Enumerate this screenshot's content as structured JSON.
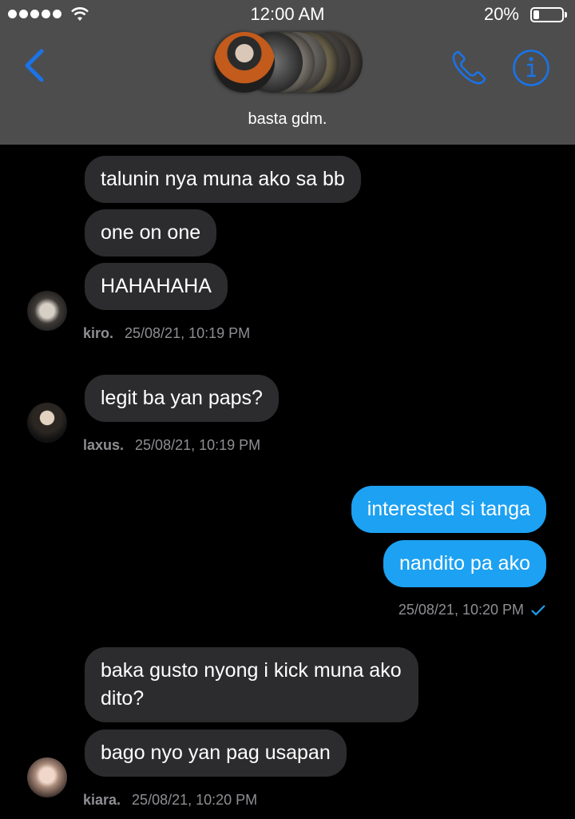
{
  "status_bar": {
    "time": "12:00 AM",
    "battery_percent": "20%",
    "battery_level": 0.2,
    "signal_icon": "signal-dots-icon",
    "wifi_icon": "wifi-icon"
  },
  "header": {
    "group_name": "basta gdm.",
    "back_icon": "chevron-left-icon",
    "call_icon": "phone-icon",
    "info_icon": "info-icon",
    "accent_color": "#1a73e8"
  },
  "messages": [
    {
      "from": "kiro.",
      "text": "talunin nya muna ako sa bb"
    },
    {
      "from": "kiro.",
      "text": "one on one"
    },
    {
      "from": "kiro.",
      "text": "HAHAHAHA"
    },
    {
      "from": "laxus.",
      "text": "legit ba yan paps?"
    },
    {
      "from": "me",
      "text": "interested si tanga"
    },
    {
      "from": "me",
      "text": "nandito pa ako"
    },
    {
      "from": "kiara.",
      "text": "baka gusto nyong i kick muna ako dito?"
    },
    {
      "from": "kiara.",
      "text": "bago nyo yan pag usapan"
    }
  ],
  "meta": {
    "kiro": {
      "name": "kiro.",
      "timestamp": "25/08/21, 10:19 PM"
    },
    "laxus": {
      "name": "laxus.",
      "timestamp": "25/08/21, 10:19 PM"
    },
    "me": {
      "timestamp": "25/08/21, 10:20 PM",
      "status_icon": "checkmark-icon"
    },
    "kiara": {
      "name": "kiara.",
      "timestamp": "25/08/21, 10:20 PM"
    }
  },
  "colors": {
    "incoming_bubble": "#2c2c2e",
    "outgoing_bubble": "#1da1f2",
    "header_bg": "#4d4d4d"
  }
}
